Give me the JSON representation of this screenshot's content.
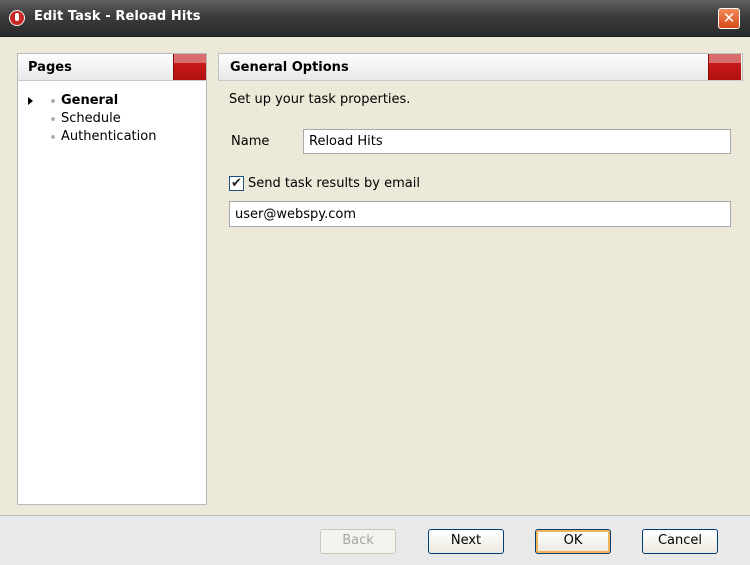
{
  "window": {
    "title": "Edit Task - Reload Hits",
    "close_label": "✕"
  },
  "pages_panel": {
    "header": "Pages",
    "items": [
      {
        "label": "General",
        "active": true
      },
      {
        "label": "Schedule",
        "active": false
      },
      {
        "label": "Authentication",
        "active": false
      }
    ]
  },
  "options_panel": {
    "header": "General Options",
    "description": "Set up your task properties.",
    "name_label": "Name",
    "name_value": "Reload Hits",
    "send_email_label": "Send task results by email",
    "send_email_checked": "✔",
    "email_value": "user@webspy.com"
  },
  "buttons": {
    "back": "Back",
    "next": "Next",
    "ok": "OK",
    "cancel": "Cancel"
  },
  "colors": {
    "accent_red": "#c81414",
    "title_bar": "#3c3c3c"
  }
}
